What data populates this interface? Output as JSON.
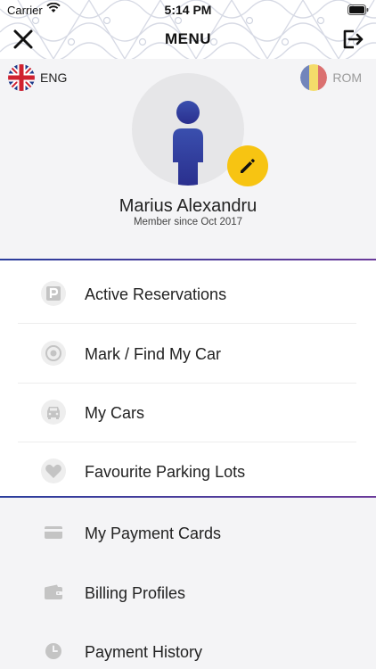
{
  "status_bar": {
    "carrier": "Carrier",
    "time": "5:14 PM"
  },
  "header": {
    "title": "MENU",
    "close_icon": "close-icon",
    "logout_icon": "logout-icon"
  },
  "languages": {
    "english": {
      "label": "ENG",
      "active": true
    },
    "romanian": {
      "label": "ROM",
      "active": false
    }
  },
  "profile": {
    "name": "Marius Alexandru",
    "member_since": "Member since Oct 2017"
  },
  "menu": {
    "primary": [
      {
        "label": "Active Reservations",
        "icon": "parking-icon"
      },
      {
        "label": "Mark / Find My Car",
        "icon": "target-icon"
      },
      {
        "label": "My Cars",
        "icon": "car-icon"
      },
      {
        "label": "Favourite Parking Lots",
        "icon": "heart-icon"
      }
    ],
    "secondary": [
      {
        "label": "My Payment Cards",
        "icon": "credit-card-icon"
      },
      {
        "label": "Billing Profiles",
        "icon": "wallet-icon"
      },
      {
        "label": "Payment History",
        "icon": "clock-icon"
      }
    ]
  },
  "colors": {
    "accent_yellow": "#f7c412",
    "avatar_blue": "#2a3d9c",
    "divider_gradient_start": "#2a3d9c",
    "divider_gradient_end": "#6a3a9a",
    "icon_gray": "#c4c4c4"
  }
}
